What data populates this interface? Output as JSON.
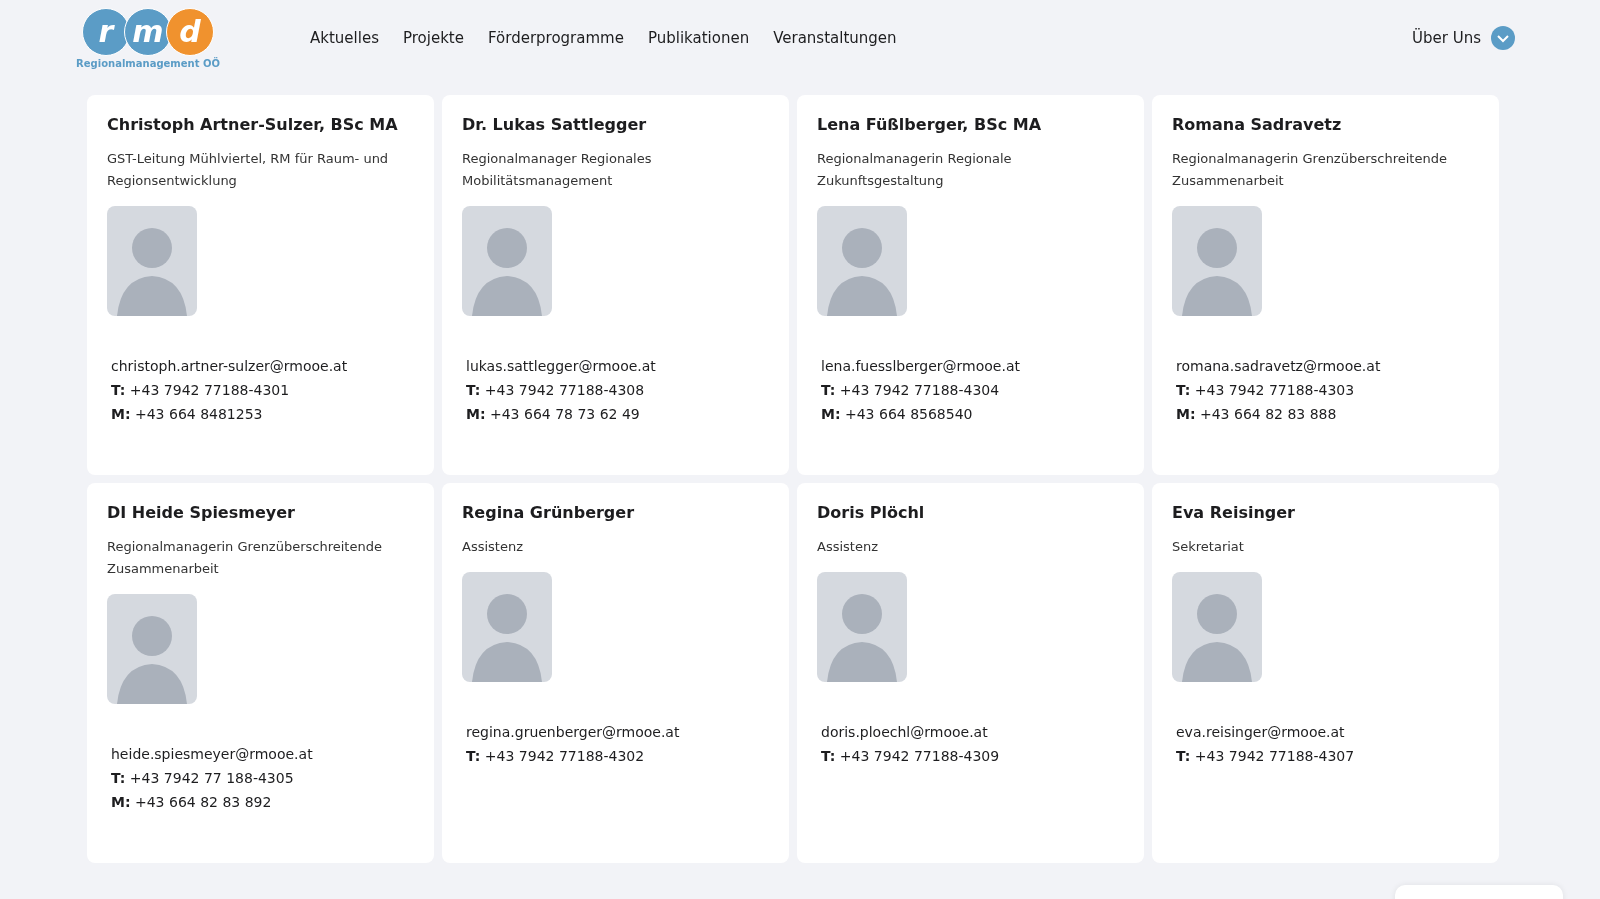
{
  "logo": {
    "letters": [
      "r",
      "m",
      "d"
    ],
    "subtitle": "Regionalmanagement OÖ"
  },
  "nav": {
    "items": [
      "Aktuelles",
      "Projekte",
      "Förderprogramme",
      "Publikationen",
      "Veranstaltungen"
    ],
    "dropdown": {
      "label": "Über Uns",
      "expanded": false
    }
  },
  "people": [
    {
      "name": "Christoph Artner-Sulzer, BSc MA",
      "role": "GST-Leitung Mühlviertel, RM für Raum- und Regionsentwicklung",
      "email": "christoph.artner-sulzer@rmooe.at",
      "phones": [
        "**T:** +43 7942 77188-4301",
        "**M:** +43 664 8481253"
      ]
    },
    {
      "name": "Dr. Lukas Sattlegger",
      "role": "Regionalmanager Regionales Mobilitätsmanagement",
      "email": "lukas.sattlegger@rmooe.at",
      "phones": [
        "**T:** +43 7942 77188-4308",
        "**M:** +43 664 78 73 62 49"
      ]
    },
    {
      "name": "Lena Füßlberger, BSc MA",
      "role": "Regionalmanagerin Regionale Zukunftsgestaltung",
      "email": "lena.fuesslberger@rmooe.at",
      "phones": [
        "**T:** +43 7942 77188-4304",
        "**M:** +43 664 8568540"
      ]
    },
    {
      "name": "Romana Sadravetz",
      "role": "Regionalmanagerin Grenzüberschreitende Zusammenarbeit",
      "email": "romana.sadravetz@rmooe.at",
      "phones": [
        "**T:** +43 7942 77188-4303",
        "**M:** +43 664 82 83 888"
      ]
    },
    {
      "name": "DI Heide Spiesmeyer",
      "role": "Regionalmanagerin Grenzüberschreitende Zusammenarbeit",
      "email": "heide.spiesmeyer@rmooe.at",
      "phones": [
        "**T:** +43 7942 77 188-4305",
        "**M:** +43 664 82 83 892"
      ]
    },
    {
      "name": "Regina Grünberger",
      "role": "Assistenz",
      "email": "regina.gruenberger@rmooe.at",
      "phones": [
        "**T:** +43 7942 77188-4302"
      ]
    },
    {
      "name": "Doris Plöchl",
      "role": "Assistenz",
      "email": "doris.ploechl@rmooe.at",
      "phones": [
        "**T:** +43 7942 77188-4309"
      ]
    },
    {
      "name": "Eva Reisinger",
      "role": "Sekretariat",
      "email": "eva.reisinger@rmooe.at",
      "phones": [
        "**T:** +43 7942 77188-4307"
      ]
    }
  ]
}
